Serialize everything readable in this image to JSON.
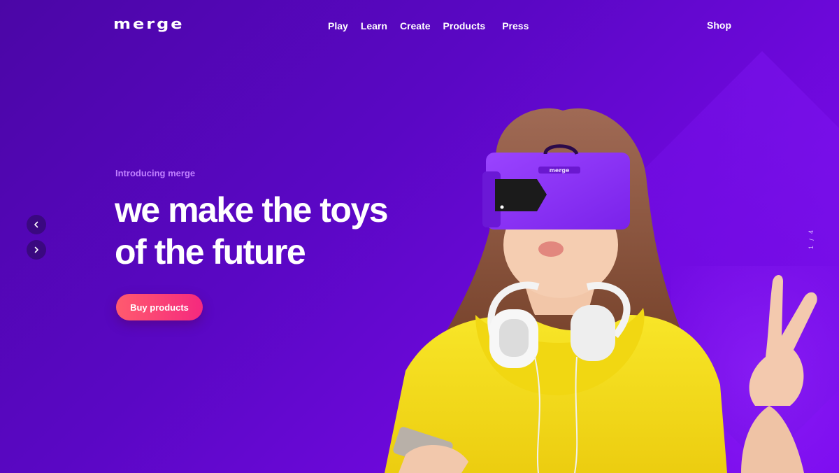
{
  "header": {
    "logo": "merge",
    "nav": [
      "Play",
      "Learn",
      "Create",
      "Products",
      "Press"
    ],
    "shop": "Shop"
  },
  "hero": {
    "intro": "Introducing merge",
    "headline_line1": "we make the toys",
    "headline_line2": "of the future",
    "cta": "Buy products"
  },
  "slider": {
    "current": "1",
    "separator": "/",
    "total": "4",
    "prev_icon": "chevron-left-icon",
    "next_icon": "chevron-right-icon"
  },
  "headset_logo": "merge",
  "colors": {
    "background": "#5a07c4",
    "accent_start": "#ff5b6e",
    "accent_end": "#f5297e",
    "intro_text": "#c080ff",
    "headset": "#8b2cf5",
    "sweater": "#f6e01a"
  }
}
